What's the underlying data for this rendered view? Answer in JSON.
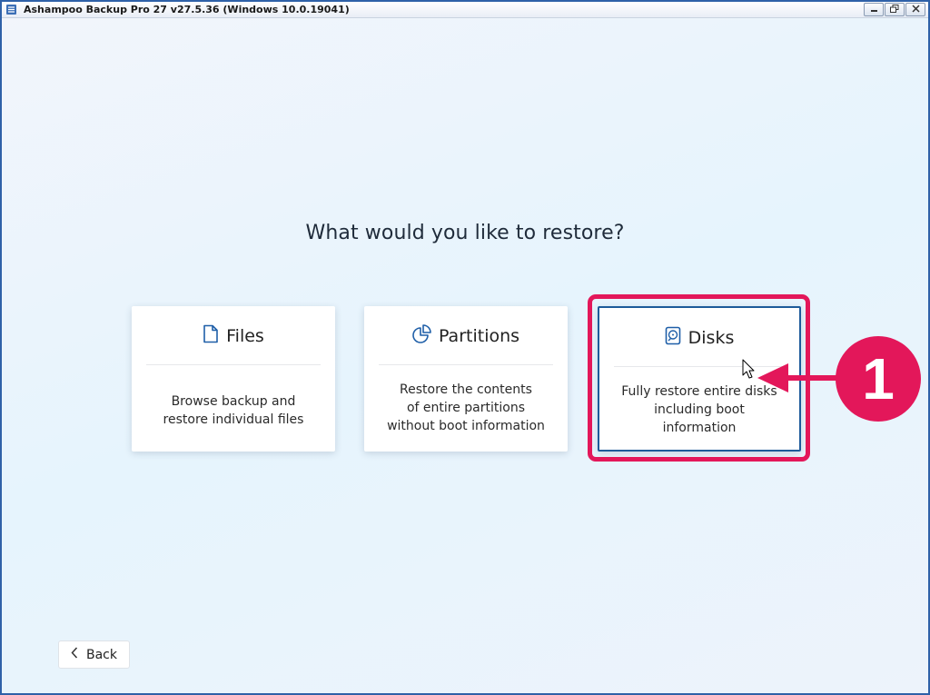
{
  "window": {
    "title": "Ashampoo Backup Pro 27 v27.5.36 (Windows 10.0.19041)",
    "controls": [
      "minimize-icon",
      "restore-icon",
      "close-icon"
    ]
  },
  "main": {
    "question": "What would you like to restore?",
    "cards": [
      {
        "title": "Files",
        "icon": "file-icon",
        "description": "Browse backup and\nrestore individual files"
      },
      {
        "title": "Partitions",
        "icon": "partition-icon",
        "description": "Restore the contents\nof entire partitions\nwithout boot information"
      },
      {
        "title": "Disks",
        "icon": "disk-icon",
        "description": "Fully restore entire disks\nincluding boot\ninformation",
        "selected": true
      }
    ]
  },
  "annotation": {
    "step_number": "1",
    "color": "#e3175a"
  },
  "footer": {
    "back_label": "Back"
  },
  "colors": {
    "accent": "#1d5b9a",
    "annotation": "#e3175a"
  }
}
